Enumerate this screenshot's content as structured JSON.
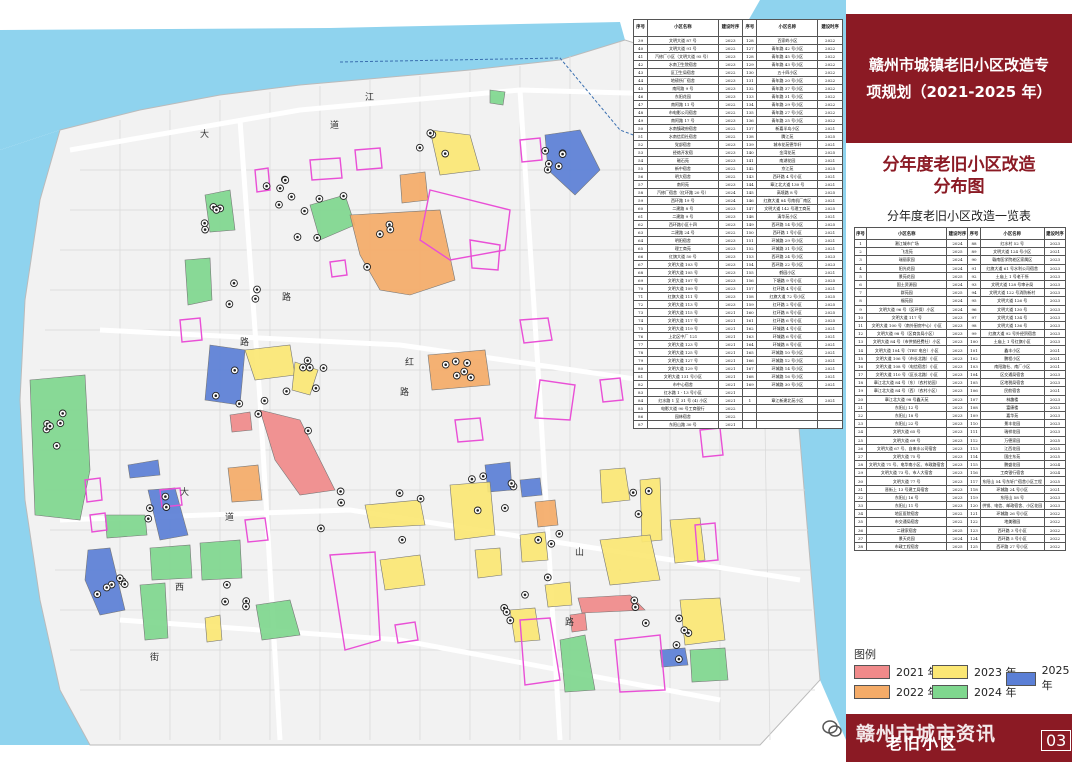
{
  "panel": {
    "title": "赣州市城镇老旧小区改造专项规划（2021-2025 年）",
    "subtitle_line1": "分年度老旧小区改造",
    "subtitle_line2": "分布图",
    "list_heading": "分年度老旧小区改造一览表",
    "legend_title": "图例",
    "legend": [
      {
        "label": "2021 年",
        "color": "#f08a8a"
      },
      {
        "label": "2023 年",
        "color": "#fbe774"
      },
      {
        "label": "2025 年",
        "color": "#5b7fd6"
      },
      {
        "label": "2022 年",
        "color": "#f4ab68"
      },
      {
        "label": "2024 年",
        "color": "#7fd78e"
      }
    ],
    "bottom_label": "老旧小区",
    "watermark": "赣州市城市资讯",
    "page_number": "03"
  },
  "table_a": {
    "headers": [
      "序号",
      "小区名称",
      "建设时序",
      "序号",
      "小区名称",
      "建设时序"
    ],
    "rows": [
      [
        "39",
        "文明大道 87 号",
        "2023",
        "128",
        "百家岭小区",
        "2022"
      ],
      [
        "40",
        "文明大道 91 号",
        "2022",
        "127",
        "青年路 42 号小区",
        "2022"
      ],
      [
        "41",
        "汽修厂小区（文明大道 95 号）",
        "2023",
        "128",
        "青年路 45 号小区",
        "2022"
      ],
      [
        "42",
        "水南卫生院宿舍",
        "2023",
        "129",
        "青年路 43 号小区",
        "2022"
      ],
      [
        "43",
        "区卫生局宿舍",
        "2022",
        "130",
        "五十四小区",
        "2022"
      ],
      [
        "44",
        "地磅所厂宿舍",
        "2023",
        "131",
        "青年路 20 号小区",
        "2022"
      ],
      [
        "45",
        "南阿路 9 号",
        "2023",
        "132",
        "青年路 37 号小区",
        "2022"
      ],
      [
        "46",
        "东阳花园",
        "2023",
        "133",
        "青年路 31 号小区",
        "2022"
      ],
      [
        "47",
        "南阿路 11 号",
        "2022",
        "134",
        "青年路 29 号小区",
        "2022"
      ],
      [
        "48",
        "市电影公司宿舍",
        "2022",
        "135",
        "青年路 27 号小区",
        "2022"
      ],
      [
        "49",
        "南阿路 17 号",
        "2023",
        "136",
        "青年路 25 号小区",
        "2022"
      ],
      [
        "50",
        "水南镇政府宿舍",
        "2022",
        "137",
        "新嘉半岛小区",
        "2021"
      ],
      [
        "51",
        "水南信用社宿舍",
        "2022",
        "138",
        "腾江苑",
        "2025"
      ],
      [
        "52",
        "党部宿舍",
        "2023",
        "139",
        "城市花苑德华轩",
        "2021"
      ],
      [
        "53",
        "经络开发宿",
        "2023",
        "140",
        "金湾花苑",
        "2025"
      ],
      [
        "54",
        "磁石苑",
        "2023",
        "141",
        "南湖花园",
        "2021"
      ],
      [
        "55",
        "新中宿舍",
        "2022",
        "142",
        "京江苑",
        "2025"
      ],
      [
        "56",
        "明大宿舍",
        "2022",
        "143",
        "西环路 4 号小区",
        "2021"
      ],
      [
        "57",
        "南阿苑",
        "2023",
        "144",
        "章江北大道 130 号",
        "2021"
      ],
      [
        "58",
        "汽修厂宿舍（红环路 20 号）",
        "2024",
        "145",
        "高境路 8 号",
        "2025"
      ],
      [
        "59",
        "西环路 19 号",
        "2024",
        "146",
        "红旗大道 84 号南机厂南区",
        "2021"
      ],
      [
        "60",
        "二建路 8 号",
        "2023",
        "147",
        "文明大道 142 号理工商苑",
        "2025"
      ],
      [
        "61",
        "二建路 9 号",
        "2023",
        "148",
        "清华苑小区",
        "2021"
      ],
      [
        "62",
        "西环路小区十四",
        "2023",
        "149",
        "西环路 14 号小区",
        "2025"
      ],
      [
        "63",
        "二建路 24 号",
        "2022",
        "150",
        "西环路 1 号小区",
        "2021"
      ],
      [
        "64",
        "明阳宿舍",
        "2023",
        "151",
        "环城路 29 号小区",
        "2021"
      ],
      [
        "65",
        "理工商苑",
        "2023",
        "152",
        "环城路 31 号小区",
        "2021"
      ],
      [
        "66",
        "红旗大道 50 号",
        "2023",
        "153",
        "西环路 24 号小区",
        "2023"
      ],
      [
        "67",
        "文明大道 103 号",
        "2023",
        "154",
        "西环路 22 号小区",
        "2023"
      ],
      [
        "68",
        "文明大道 105 号",
        "2023",
        "155",
        "鹤园小区",
        "2021"
      ],
      [
        "69",
        "文明大道 107 号",
        "2023",
        "156",
        "下塘路 9 号小区",
        "2025"
      ],
      [
        "70",
        "文明大道 109 号",
        "2023",
        "157",
        "红环路 4 号小区",
        "2021"
      ],
      [
        "71",
        "红旗大道 111 号",
        "2023",
        "158",
        "红旗大道 72 号小区",
        "2025"
      ],
      [
        "72",
        "文明大道 113 号",
        "2023",
        "159",
        "红环路 2 号小区",
        "2025"
      ],
      [
        "73",
        "文明大道 115 号",
        "2021",
        "160",
        "红环路 8 号小区",
        "2025"
      ],
      [
        "74",
        "文明大道 117 号",
        "2021",
        "161",
        "红环路 6 号小区",
        "2025"
      ],
      [
        "75",
        "文明大道 119 号",
        "2021",
        "162",
        "环城路 4 号小区",
        "2021"
      ],
      [
        "76",
        "上北区中厂 121",
        "2021",
        "163",
        "环城路 6 号小区",
        "2021"
      ],
      [
        "77",
        "文明大道 123 号",
        "2021",
        "164",
        "环城路 8 号小区",
        "2021"
      ],
      [
        "78",
        "文明大道 125 号",
        "2021",
        "165",
        "环城路 10 号小区",
        "2021"
      ],
      [
        "79",
        "文明大道 127 号",
        "2021",
        "166",
        "环城路 12 号小区",
        "2021"
      ],
      [
        "80",
        "文明大道 129 号",
        "2021",
        "167",
        "环城路 14 号小区",
        "2021"
      ],
      [
        "81",
        "文明大道 131 号小区",
        "2021",
        "168",
        "环城路 16 号小区",
        "2021"
      ],
      [
        "82",
        "市中心宿舍",
        "2021",
        "169",
        "环城路 30 号小区",
        "2021"
      ],
      [
        "83",
        "红水路 1 - 13 号小区",
        "2021",
        "",
        "",
        ""
      ],
      [
        "84",
        "红水路 1 至 31 号 (4) 小区",
        "2021",
        "1",
        "章江新建北苑小区",
        "2021"
      ],
      [
        "85",
        "电影大道 90 号工商银行",
        "2022",
        "",
        "",
        ""
      ],
      [
        "86",
        "园林宿舍",
        "2022",
        "",
        "",
        ""
      ],
      [
        "87",
        "东阳山路 30 号",
        "2021",
        "",
        "",
        ""
      ]
    ]
  },
  "table_b": {
    "headers": [
      "序号",
      "小区名称",
      "建设时序",
      "序号",
      "小区名称",
      "建设时序"
    ],
    "rows": [
      [
        "1",
        "潮江城市广场",
        "2024",
        "88",
        "红水村 52 号",
        "2023"
      ],
      [
        "2",
        "飞龙苑",
        "2025",
        "89",
        "文明大道 124 号小区",
        "2021"
      ],
      [
        "3",
        "瑞丽家园",
        "2024",
        "90",
        "赣南医学院老区家属区",
        "2023"
      ],
      [
        "4",
        "阳光花园",
        "2024",
        "91",
        "红旗大道 61 号水利公司宿舍",
        "2023"
      ],
      [
        "5",
        "景苑花园",
        "2025",
        "92",
        "土庙上 1 号老干所",
        "2023"
      ],
      [
        "6",
        "国土资源园",
        "2024",
        "93",
        "文明大道 128 号审计局",
        "2023"
      ],
      [
        "7",
        "群苑园",
        "2025",
        "94",
        "文明大道 122 号消防新村",
        "2023"
      ],
      [
        "8",
        "福苑园",
        "2024",
        "95",
        "文明大道 126 号",
        "2023"
      ],
      [
        "9",
        "文明大道 96 号（区环保）小区",
        "2024",
        "96",
        "文明大道 130 号",
        "2023"
      ],
      [
        "10",
        "文明大道 117 号",
        "2023",
        "97",
        "文明大道 134 号",
        "2023"
      ],
      [
        "11",
        "文明大道 100 号（南外厨房中心）小区",
        "2023",
        "98",
        "文明大道 136 号",
        "2023"
      ],
      [
        "12",
        "文明大道 98 号（区商务局小区）",
        "2023",
        "99",
        "红旗大道 92 号外经贸宿舍",
        "2023"
      ],
      [
        "13",
        "文明大道 84 号（市供销经费社）小区",
        "2023",
        "100",
        "土庙上 1 号红旗小区",
        "2023"
      ],
      [
        "14",
        "文明大道 104 号（TRT 电台）小区",
        "2023",
        "101",
        "鑫丰小区",
        "2021"
      ],
      [
        "15",
        "文明大道 106 号（市长北路）小区",
        "2023",
        "102",
        "鹏程小区",
        "2021"
      ],
      [
        "16",
        "文明大道 108 号（电信宿舍）小区",
        "2023",
        "103",
        "南阳路社、南厂小区",
        "2021"
      ],
      [
        "17",
        "文明大道 110 号（区长北路）小区",
        "2023",
        "104",
        "区交通局宿舍",
        "2023"
      ],
      [
        "18",
        "章江北大道 84 号（东）（农村花园）",
        "2023",
        "105",
        "区地税局宿舍",
        "2023"
      ],
      [
        "19",
        "章江北大道 84 号（西）（农村小区）",
        "2023",
        "106",
        "民航宿舍",
        "2021"
      ],
      [
        "20",
        "章江北大道 98 号鑫天苑",
        "2023",
        "107",
        "林趣楼",
        "2023"
      ],
      [
        "21",
        "东阳山 12 号",
        "2023",
        "108",
        "富康楼",
        "2023"
      ],
      [
        "22",
        "东阳山 18 号",
        "2023",
        "109",
        "嘉华苑",
        "2023"
      ],
      [
        "23",
        "东阳山 22 号",
        "2023",
        "110",
        "景丰花园",
        "2023"
      ],
      [
        "24",
        "文明大道 65 号",
        "2023",
        "111",
        "瑞祥花园",
        "2023"
      ],
      [
        "25",
        "文明大道 69 号",
        "2023",
        "112",
        "万德家园",
        "2025"
      ],
      [
        "26",
        "文明大道 67 号、自来水公司宿舍",
        "2023",
        "113",
        "江西花园",
        "2025"
      ],
      [
        "27",
        "文明大道 75 号",
        "2023",
        "114",
        "国庄东苑",
        "2025"
      ],
      [
        "28",
        "文明大道 71 号、电华南小区、市政路宿舍",
        "2023",
        "115",
        "鹏盛花园",
        "2024"
      ],
      [
        "29",
        "文明大道 73 号、市人大宿舍",
        "2023",
        "116",
        "工商银行宿舍",
        "2024"
      ],
      [
        "30",
        "文明大道 77 号",
        "2023",
        "117",
        "东阳山 54 号东轩广宿舍小区工程",
        "2025"
      ],
      [
        "31",
        "晋街上 13 号建工局宿舍",
        "2023",
        "118",
        "环城路 24 号小区",
        "2021"
      ],
      [
        "32",
        "东阳山 16 号",
        "2023",
        "119",
        "东阳山 58 号",
        "2023"
      ],
      [
        "33",
        "东阳山 11 号",
        "2023",
        "120",
        "供销、电信、邮政宿舍、小区花园",
        "2023"
      ],
      [
        "34",
        "地区医院宿舍",
        "2022",
        "121",
        "环城路 26 号小区",
        "2022"
      ],
      [
        "35",
        "市交通局宿舍",
        "2022",
        "122",
        "地美雅园",
        "2022"
      ],
      [
        "36",
        "二建家宿舍",
        "2025",
        "123",
        "西环路 3 号小区",
        "2022"
      ],
      [
        "37",
        "景天花园",
        "2024",
        "124",
        "西环路 5 号小区",
        "2022"
      ],
      [
        "38",
        "市政工程宿舍",
        "2025",
        "125",
        "西环路 27 号小区",
        "2022"
      ]
    ]
  },
  "map": {
    "river_labels": [
      "江",
      "大",
      "道",
      "路",
      "大",
      "道",
      "西",
      "街",
      "路",
      "红",
      "路",
      "山",
      "路",
      "江"
    ],
    "colors": {
      "y2021": "#f08a8a",
      "y2022": "#f4ab68",
      "y2023": "#fbe774",
      "y2024": "#7fd78e",
      "y2025": "#5b7fd6",
      "outline": "#e94fd6",
      "water": "#8fd3ee",
      "land": "#f4f4f4",
      "road": "#ffffff",
      "road_border": "#c9c9c9"
    }
  }
}
